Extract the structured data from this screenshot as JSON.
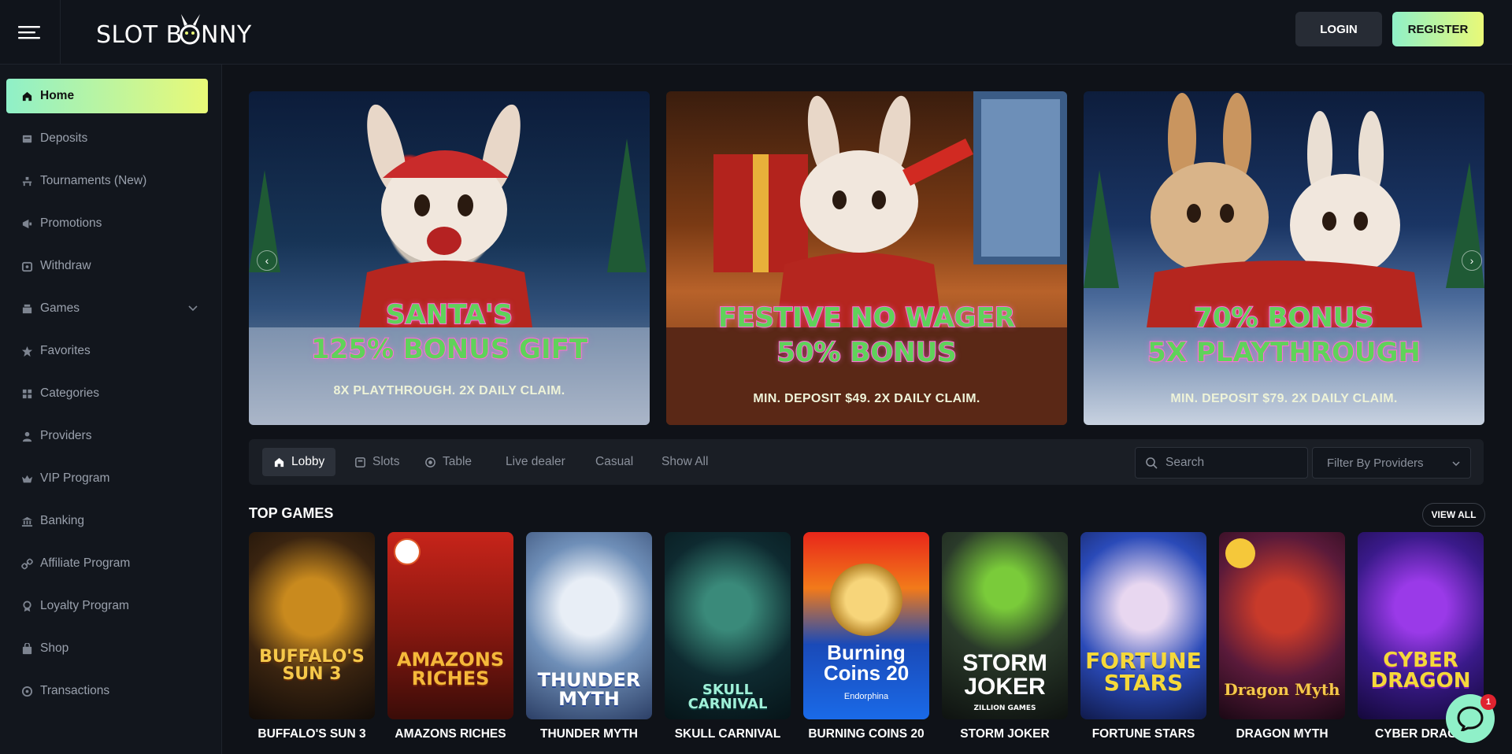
{
  "brand": {
    "logo_text": "SLOT BUNNY",
    "accent_gradient": [
      "#8ff0c8",
      "#e9f977"
    ]
  },
  "header": {
    "login_label": "LOGIN",
    "register_label": "REGISTER"
  },
  "sidebar": {
    "items": [
      {
        "label": "Home",
        "icon": "home-icon",
        "active": true
      },
      {
        "label": "Deposits",
        "icon": "deposit-icon"
      },
      {
        "label": "Tournaments (New)",
        "icon": "tournament-icon"
      },
      {
        "label": "Promotions",
        "icon": "megaphone-icon"
      },
      {
        "label": "Withdraw",
        "icon": "withdraw-icon"
      },
      {
        "label": "Games",
        "icon": "games-icon",
        "expandable": true
      },
      {
        "label": "Favorites",
        "icon": "star-icon"
      },
      {
        "label": "Categories",
        "icon": "grid-icon"
      },
      {
        "label": "Providers",
        "icon": "user-icon"
      },
      {
        "label": "VIP Program",
        "icon": "crown-icon"
      },
      {
        "label": "Banking",
        "icon": "bank-icon"
      },
      {
        "label": "Affiliate Program",
        "icon": "link-icon"
      },
      {
        "label": "Loyalty Program",
        "icon": "badge-icon"
      },
      {
        "label": "Shop",
        "icon": "shop-icon"
      },
      {
        "label": "Transactions",
        "icon": "transactions-icon"
      }
    ]
  },
  "banners": [
    {
      "title_line1": "SANTA'S",
      "title_line2": "125% BONUS GIFT",
      "subtitle": "8X PLAYTHROUGH. 2X DAILY CLAIM."
    },
    {
      "title_line1": "FESTIVE NO WAGER",
      "title_line2": "50% BONUS",
      "subtitle": "MIN. DEPOSIT $49. 2X DAILY CLAIM."
    },
    {
      "title_line1": "70% BONUS",
      "title_line2": "5X PLAYTHROUGH",
      "subtitle": "MIN. DEPOSIT $79. 2X DAILY CLAIM."
    }
  ],
  "tabs": [
    {
      "label": "Lobby",
      "icon": "home-icon",
      "active": true
    },
    {
      "label": "Slots",
      "icon": "slots-icon"
    },
    {
      "label": "Table",
      "icon": "table-icon"
    },
    {
      "label": "Live dealer"
    },
    {
      "label": "Casual"
    },
    {
      "label": "Show All"
    }
  ],
  "search": {
    "placeholder": "Search"
  },
  "filter": {
    "label": "Filter By Providers"
  },
  "top_games": {
    "title": "TOP GAMES",
    "view_all_label": "VIEW ALL",
    "games": [
      {
        "name": "BUFFALO'S SUN 3",
        "logo": "BUFFALO'S SUN 3"
      },
      {
        "name": "AMAZONS RICHES",
        "logo": "AMAZONS RICHES"
      },
      {
        "name": "THUNDER MYTH",
        "logo": "THUNDER MYTH"
      },
      {
        "name": "SKULL CARNIVAL",
        "logo": "SKULL CARNIVAL"
      },
      {
        "name": "BURNING COINS 20",
        "logo": "Burning Coins 20",
        "provider": "Endorphina"
      },
      {
        "name": "STORM JOKER",
        "logo": "STORM JOKER",
        "provider": "ZILLION GAMES"
      },
      {
        "name": "FORTUNE STARS",
        "logo": "FORTUNE STARS"
      },
      {
        "name": "DRAGON MYTH",
        "logo": "Dragon Myth"
      },
      {
        "name": "CYBER DRAGON",
        "logo": "CYBER DRAGON"
      }
    ]
  },
  "chat": {
    "badge_count": "1"
  }
}
